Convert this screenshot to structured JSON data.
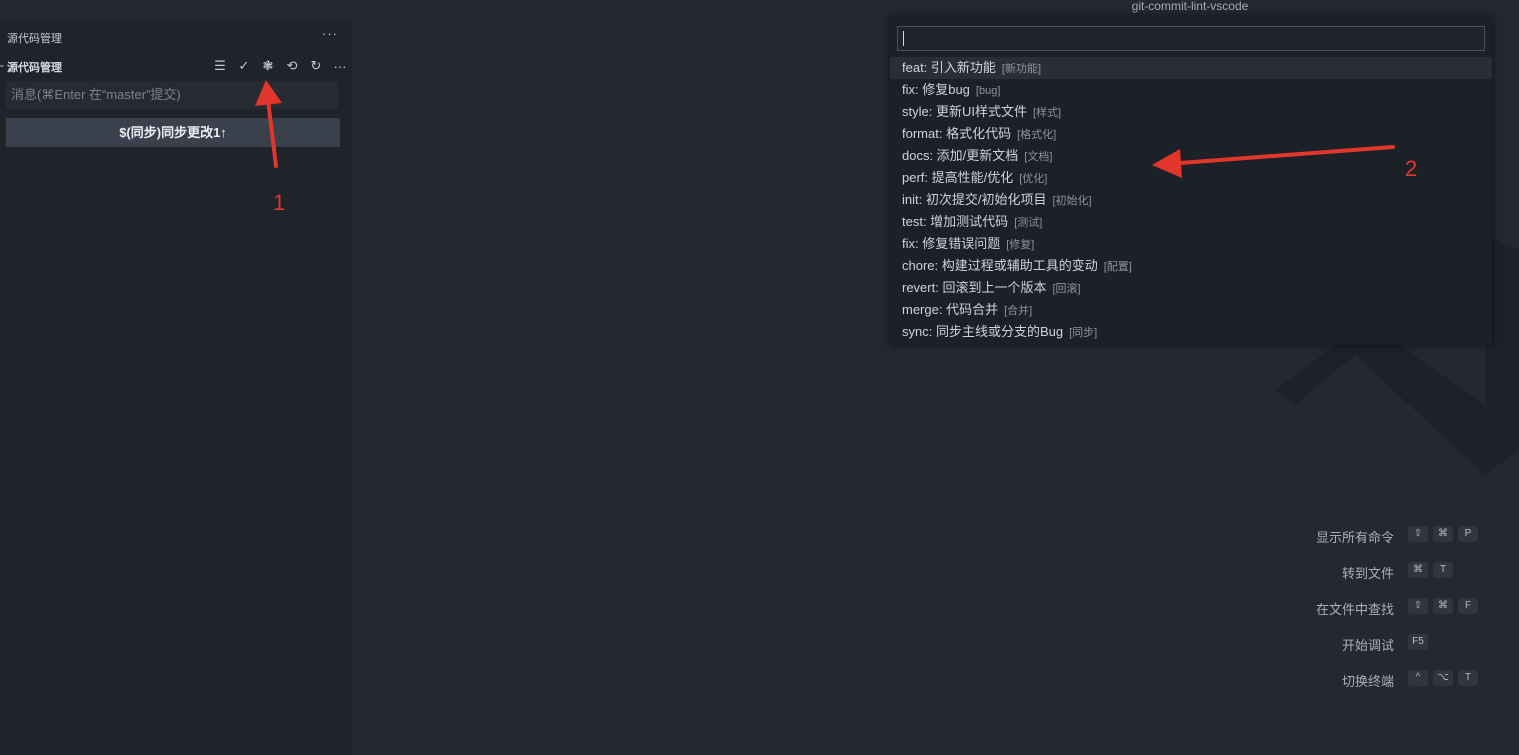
{
  "window": {
    "title": "git-commit-lint-vscode"
  },
  "sidebar": {
    "header": "源代码管理",
    "more": "···",
    "section_chevron": "⌄",
    "section_title": "源代码管理",
    "actions": [
      {
        "name": "view-as-tree-icon",
        "glyph": "☰"
      },
      {
        "name": "commit-check-icon",
        "glyph": "✓"
      },
      {
        "name": "git-commit-lint-icon",
        "glyph": "❃"
      },
      {
        "name": "history-icon",
        "glyph": "⟲"
      },
      {
        "name": "refresh-icon",
        "glyph": "↻"
      },
      {
        "name": "more-actions-icon",
        "glyph": "···"
      }
    ],
    "message_placeholder": "消息(⌘Enter 在“master”提交)",
    "sync_button": "$(同步)同步更改1↑"
  },
  "quickpick": {
    "input_value": "",
    "items": [
      {
        "label": "feat:  引入新功能",
        "description": "[新功能]"
      },
      {
        "label": "fix:  修复bug",
        "description": "[bug]"
      },
      {
        "label": "style:  更新UI样式文件",
        "description": "[样式]"
      },
      {
        "label": "format:  格式化代码",
        "description": "[格式化]"
      },
      {
        "label": "docs:  添加/更新文档",
        "description": "[文档]"
      },
      {
        "label": "perf:  提高性能/优化",
        "description": "[优化]"
      },
      {
        "label": "init:  初次提交/初始化项目",
        "description": "[初始化]"
      },
      {
        "label": "test:  增加测试代码",
        "description": "[测试]"
      },
      {
        "label": "fix:  修复错误问题",
        "description": "[修复]"
      },
      {
        "label": "chore:  构建过程或辅助工具的变动",
        "description": "[配置]"
      },
      {
        "label": "revert:  回滚到上一个版本",
        "description": "[回滚]"
      },
      {
        "label": "merge:  代码合并",
        "description": "[合并]"
      },
      {
        "label": "sync:  同步主线或分支的Bug",
        "description": "[同步]"
      }
    ]
  },
  "hints": [
    {
      "label": "显示所有命令",
      "keys": [
        "⇧",
        "⌘",
        "P"
      ]
    },
    {
      "label": "转到文件",
      "keys": [
        "⌘",
        "T"
      ]
    },
    {
      "label": "在文件中查找",
      "keys": [
        "⇧",
        "⌘",
        "F"
      ]
    },
    {
      "label": "开始调试",
      "keys": [
        "F5"
      ]
    },
    {
      "label": "切换终端",
      "keys": [
        "^",
        "⌥",
        "T"
      ]
    }
  ],
  "annotations": {
    "marker_1": "1",
    "marker_2": "2",
    "color": "#e2362b"
  },
  "colors": {
    "editor_bg": "#242830",
    "sidebar_bg": "#1f232a",
    "button_bg": "#3a414d",
    "quickpick_bg": "#1c2027"
  }
}
